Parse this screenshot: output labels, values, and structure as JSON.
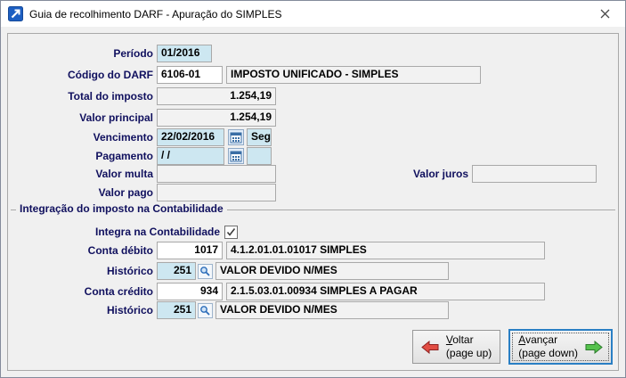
{
  "window": {
    "title": "Guia de recolhimento DARF - Apuração do SIMPLES"
  },
  "form": {
    "periodo": {
      "label": "Período",
      "value": "01/2016"
    },
    "codigo_darf": {
      "label": "Código do DARF",
      "code": "6106-01",
      "description": "IMPOSTO UNIFICADO - SIMPLES"
    },
    "total_imposto": {
      "label": "Total do imposto",
      "value": "1.254,19"
    },
    "valor_principal": {
      "label": "Valor principal",
      "value": "1.254,19"
    },
    "vencimento": {
      "label": "Vencimento",
      "date": "22/02/2016",
      "weekday": "Seg"
    },
    "pagamento": {
      "label": "Pagamento",
      "date": "/ /",
      "weekday": ""
    },
    "valor_multa": {
      "label": "Valor multa",
      "value": ""
    },
    "valor_juros": {
      "label": "Valor juros",
      "value": ""
    },
    "valor_pago": {
      "label": "Valor pago",
      "value": ""
    }
  },
  "integration": {
    "section_title": "Integração do imposto na Contabilidade",
    "integra": {
      "label": "Integra na Contabilidade",
      "checked": true
    },
    "conta_debito": {
      "label": "Conta débito",
      "code": "1017",
      "description": "4.1.2.01.01.01017 SIMPLES"
    },
    "historico_debito": {
      "label": "Histórico",
      "code": "251",
      "description": "VALOR DEVIDO N/MES"
    },
    "conta_credito": {
      "label": "Conta crédito",
      "code": "934",
      "description": "2.1.5.03.01.00934 SIMPLES A PAGAR"
    },
    "historico_credito": {
      "label": "Histórico",
      "code": "251",
      "description": "VALOR DEVIDO N/MES"
    }
  },
  "buttons": {
    "voltar": {
      "accel": "V",
      "rest": "oltar",
      "sub": "(page up)"
    },
    "avancar": {
      "accel": "A",
      "rest": "vançar",
      "sub": "(page down)"
    }
  },
  "colors": {
    "field_blue": "#cde7f1",
    "field_gray": "#f2f2f2",
    "label_navy": "#10105e",
    "focus_blue": "#2a7fc4",
    "arrow_red": "#e24d43",
    "arrow_green": "#55c24d"
  }
}
